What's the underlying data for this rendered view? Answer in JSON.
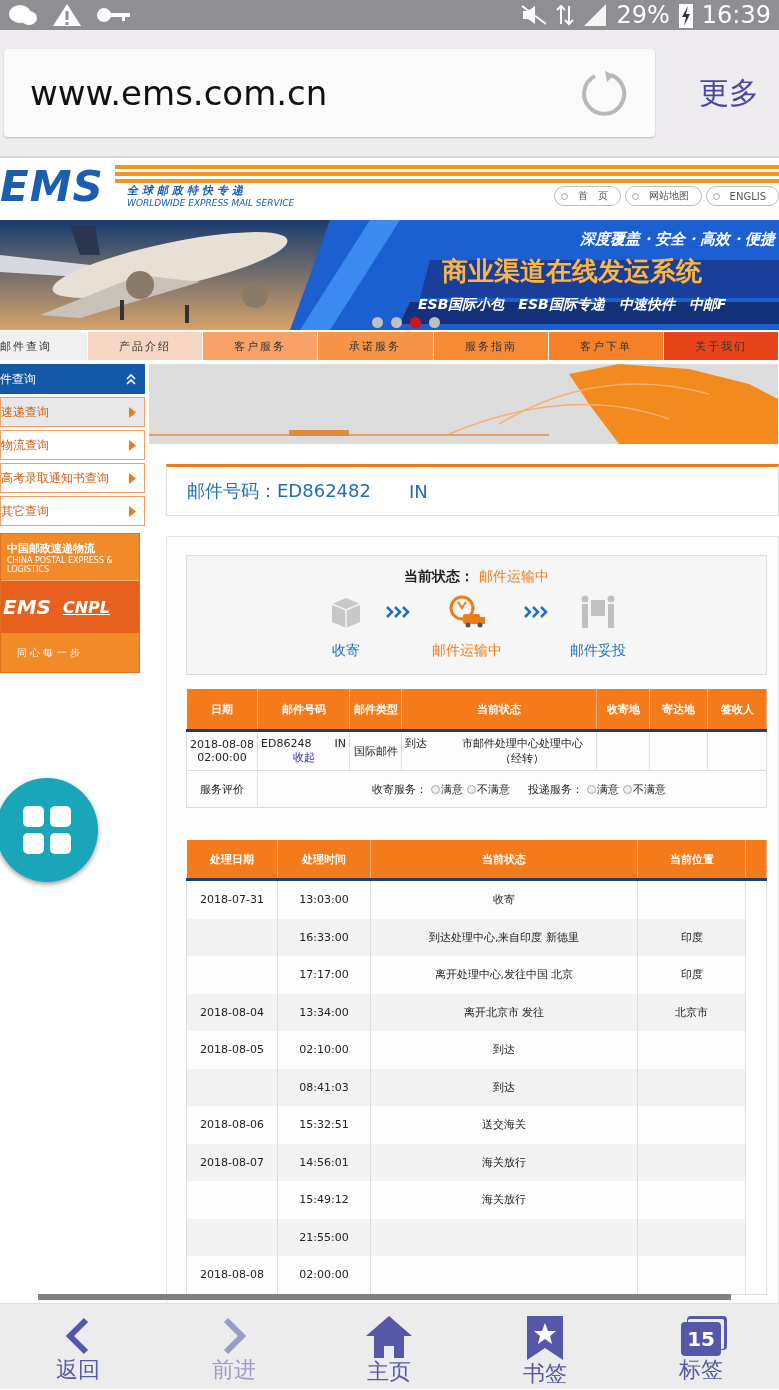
{
  "status_bar": {
    "battery": "29%",
    "time": "16:39"
  },
  "browser": {
    "url": "www.ems.com.cn",
    "more": "更多"
  },
  "site_header": {
    "logo": "EMS",
    "tagline_cn": "全球邮政特快专递",
    "tagline_en": "WORLDWIDE EXPRESS MAIL SERVICE",
    "links": [
      "首　页",
      "网站地图",
      "ENGLIS"
    ]
  },
  "banner": {
    "slogan": "深度覆盖・安全・高效・便捷",
    "title": "商业渠道在线发运系统",
    "tags": [
      "ESB国际小包",
      "ESB国际专递",
      "中速快件",
      "中邮F"
    ],
    "dots": [
      {
        "selected": false
      },
      {
        "selected": false
      },
      {
        "selected": true
      },
      {
        "selected": false
      }
    ]
  },
  "nav": [
    {
      "label": "邮件查询",
      "color": "#f0f0f0"
    },
    {
      "label": "产品介绍",
      "color": "#f6d6c2"
    },
    {
      "label": "客户服务",
      "color": "#f9a268"
    },
    {
      "label": "承诺服务",
      "color": "#f89448"
    },
    {
      "label": "服务指南",
      "color": "#f78a34"
    },
    {
      "label": "客户下单",
      "color": "#f5812a"
    },
    {
      "label": "关于我们",
      "color": "#e8451c"
    }
  ],
  "sidebar": {
    "title": "件查询",
    "expanded": true,
    "items": [
      {
        "label": "速递查询",
        "selected": true
      },
      {
        "label": "物流查询",
        "selected": false
      },
      {
        "label": "高考录取通知书查询",
        "selected": false
      },
      {
        "label": "其它查询",
        "selected": false
      }
    ],
    "ad": {
      "brand_cn": "中国邮政速递物流",
      "brand_en": "CHINA POSTAL EXPRESS & LOGISTICS",
      "logo_1": "EMS",
      "logo_2": "CNPL",
      "motto": "同 心 每 一 步"
    }
  },
  "tracking": {
    "label": "邮件号码：ED862482",
    "suffix": "IN"
  },
  "status": {
    "label": "当前状态：",
    "value": "邮件运输中",
    "steps": [
      {
        "label": "收寄",
        "kind": "box",
        "current": false
      },
      {
        "label": "邮件运输中",
        "kind": "truck",
        "current": true
      },
      {
        "label": "邮件妥投",
        "kind": "handover",
        "current": false
      }
    ]
  },
  "summary_table": {
    "columns": [
      "日期",
      "邮件号码",
      "邮件类型",
      "当前状态",
      "收寄地",
      "寄达地",
      "签收人"
    ],
    "row": {
      "date": "2018-08-08 02:00:00",
      "number": "ED86248",
      "number_suffix": "IN",
      "toggle": "收起",
      "type": "国际邮件",
      "status_prefix": "到达",
      "status": "市邮件处理中心处理中心（经转）"
    },
    "rating": {
      "label": "服务评价",
      "groups": [
        {
          "label": "收寄服务：",
          "options": [
            {
              "label": "满意",
              "selected": false
            },
            {
              "label": "不满意",
              "selected": false
            }
          ]
        },
        {
          "label": "投递服务：",
          "options": [
            {
              "label": "满意",
              "selected": false
            },
            {
              "label": "不满意",
              "selected": false
            }
          ]
        }
      ]
    }
  },
  "history_table": {
    "columns": [
      "处理日期",
      "处理时间",
      "当前状态",
      "当前位置"
    ],
    "rows": [
      {
        "date": "2018-07-31",
        "time": "13:03:00",
        "status": "收寄"
      },
      {
        "time": "16:33:00",
        "status": "到达处理中心,来自印度 新德里",
        "location": "印度"
      },
      {
        "time": "17:17:00",
        "status": "离开处理中心,发往中国 北京",
        "location": "印度"
      },
      {
        "date": "2018-08-04",
        "time": "13:34:00",
        "status": "离开北京市 发往",
        "location": "北京市"
      },
      {
        "date": "2018-08-05",
        "time": "02:10:00",
        "status": "到达"
      },
      {
        "time": "08:41:03",
        "status": "到达"
      },
      {
        "date": "2018-08-06",
        "time": "15:32:51",
        "status": "送交海关"
      },
      {
        "date": "2018-08-07",
        "time": "14:56:01",
        "status": "海关放行"
      },
      {
        "time": "15:49:12",
        "status": "海关放行"
      },
      {
        "time": "21:55:00"
      },
      {
        "date": "2018-08-08",
        "time": "02:00:00"
      }
    ]
  },
  "bottom_nav": [
    {
      "label": "返回",
      "kind": "back",
      "disabled": false
    },
    {
      "label": "前进",
      "kind": "forward",
      "disabled": true
    },
    {
      "label": "主页",
      "kind": "home",
      "disabled": false
    },
    {
      "label": "书签",
      "kind": "bookmark",
      "disabled": false
    },
    {
      "label": "标签",
      "kind": "tabs",
      "disabled": false,
      "count": "15"
    }
  ]
}
